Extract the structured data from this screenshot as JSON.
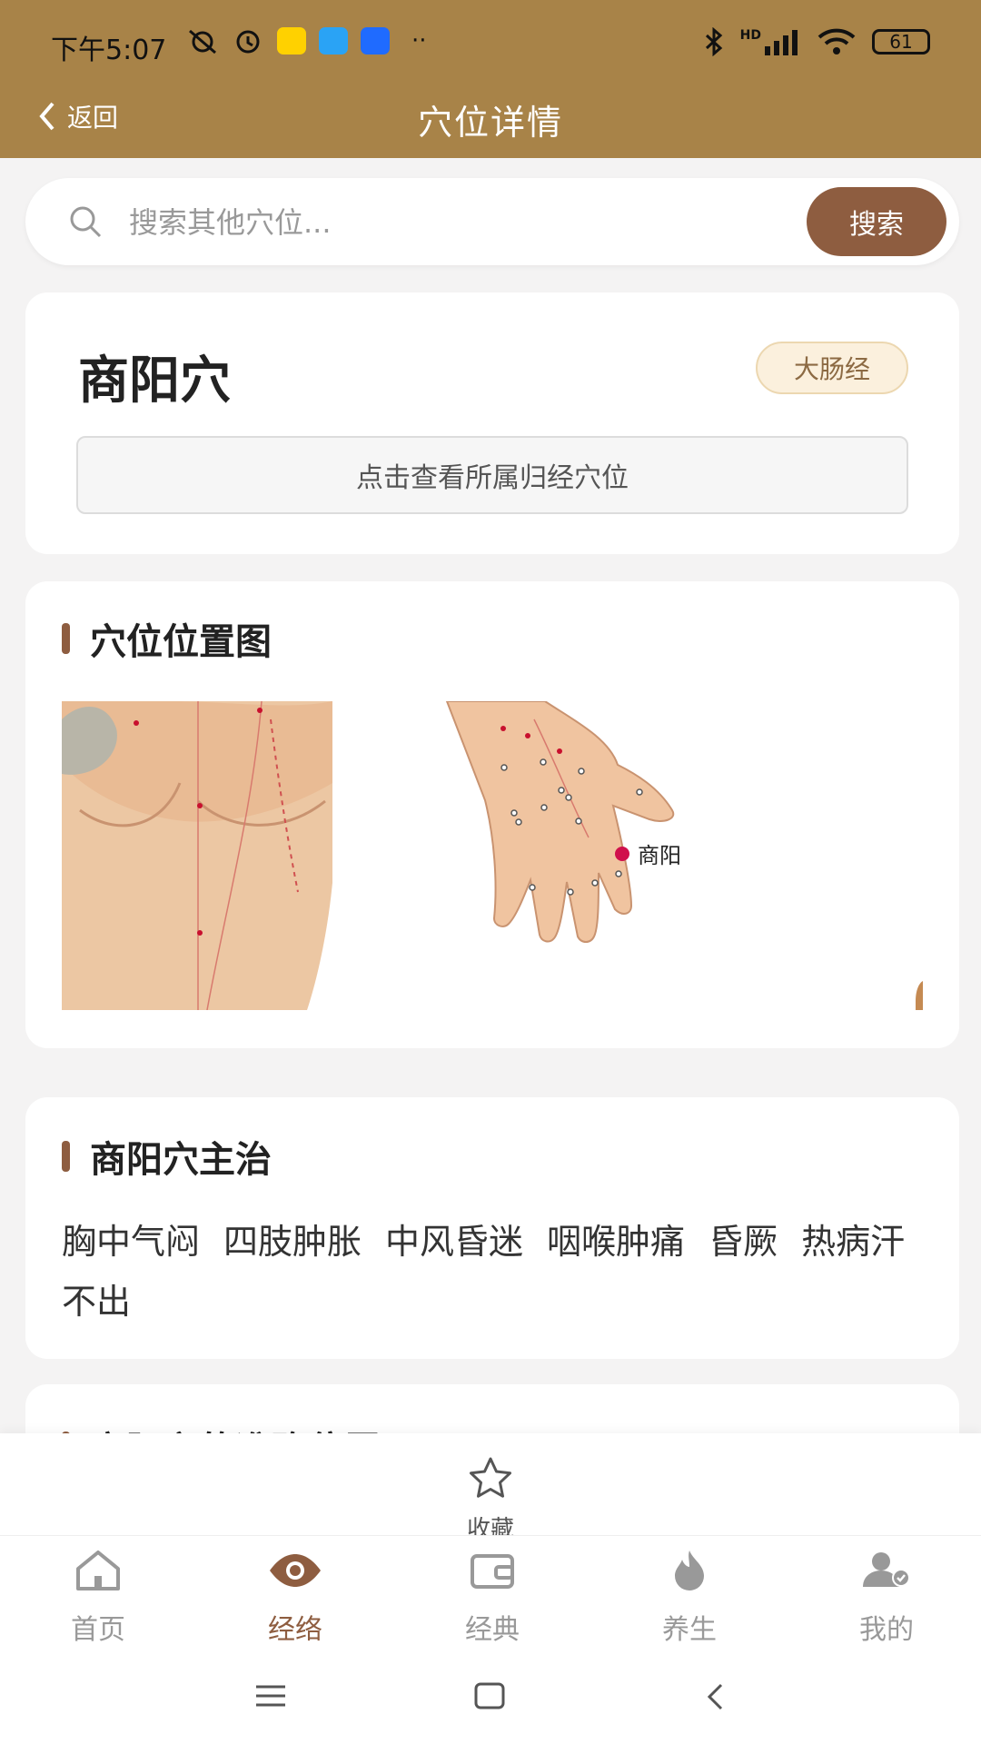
{
  "status": {
    "time": "下午5:07",
    "battery": "61",
    "network": "HD"
  },
  "header": {
    "back_label": "返回",
    "title": "穴位详情"
  },
  "search": {
    "placeholder": "搜索其他穴位...",
    "button_label": "搜索"
  },
  "acupoint": {
    "name": "商阳穴",
    "meridian_tag": "大肠经",
    "view_meridian_button": "点击查看所属归经穴位"
  },
  "location_section": {
    "title": "穴位位置图",
    "figure_label": "商阳"
  },
  "indications_section": {
    "title": "商阳穴主治",
    "items": [
      "胸中气闷",
      "四肢肿胀",
      "中风昏迷",
      "咽喉肿痛",
      "昏厥",
      "热病汗不出"
    ]
  },
  "next_section": {
    "title": "商阳穴的准确位置"
  },
  "favorite": {
    "label": "收藏"
  },
  "nav": {
    "items": [
      {
        "label": "首页",
        "icon": "home-icon"
      },
      {
        "label": "经络",
        "icon": "eye-icon"
      },
      {
        "label": "经典",
        "icon": "wallet-icon"
      },
      {
        "label": "养生",
        "icon": "flame-icon"
      },
      {
        "label": "我的",
        "icon": "user-icon"
      }
    ],
    "active": "经络"
  },
  "colors": {
    "primary": "#a88348",
    "accent": "#8e5d40",
    "point": "#d0104c"
  }
}
